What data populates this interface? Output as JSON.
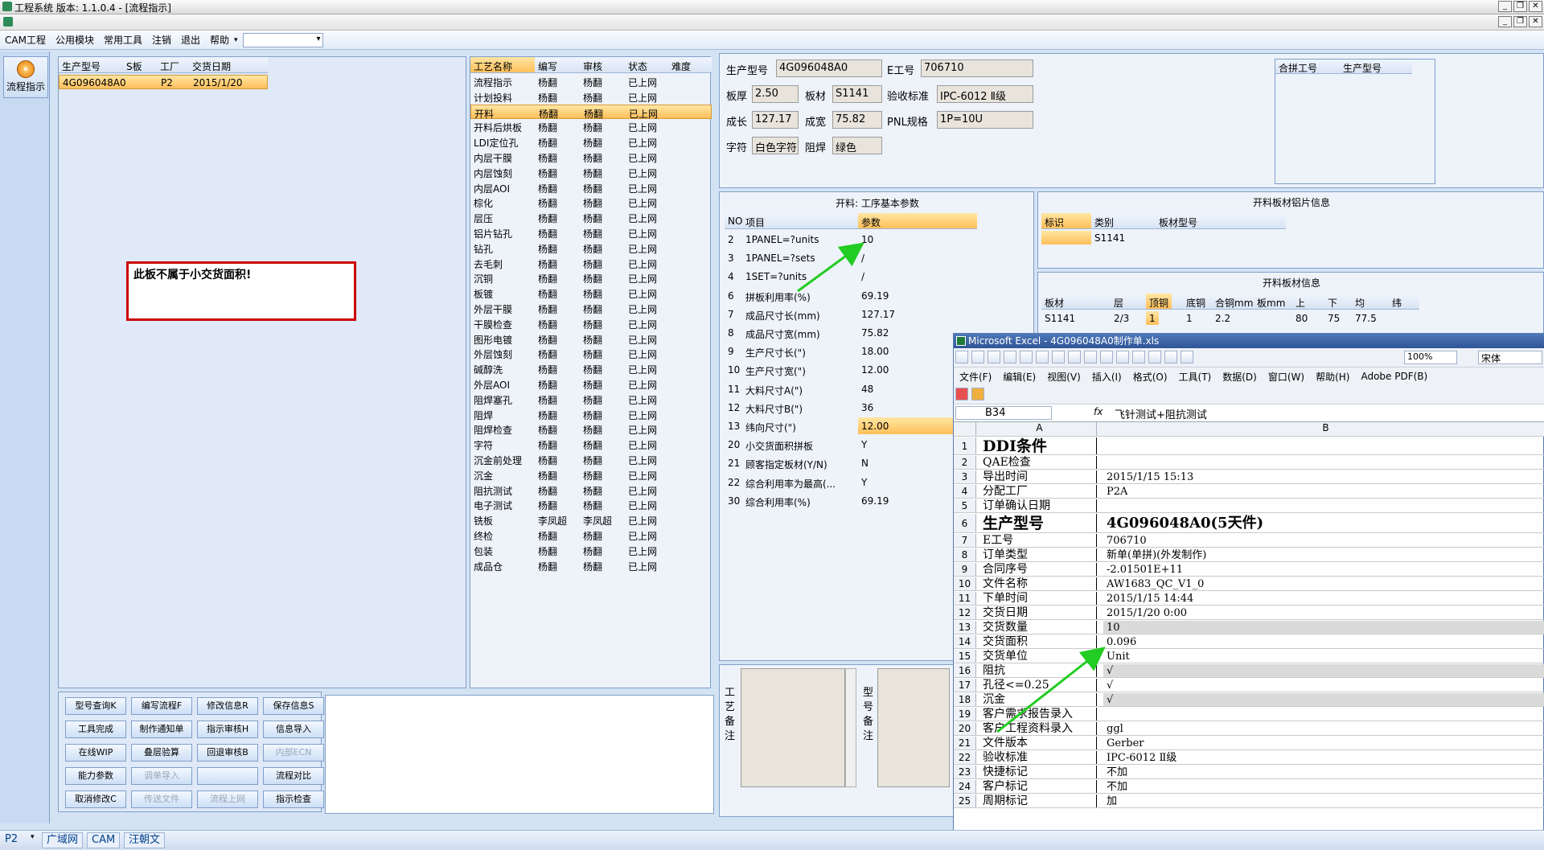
{
  "window": {
    "title": "工程系统    版本: 1.1.0.4 - [流程指示]"
  },
  "menu": {
    "items": [
      "CAM工程",
      "公用模块",
      "常用工具",
      "注销",
      "退出",
      "帮助"
    ]
  },
  "left_nav": {
    "flow_label": "流程指示"
  },
  "model_grid": {
    "headers": [
      "生产型号",
      "S板",
      "工厂",
      "交货日期"
    ],
    "row": [
      "4G096048A0",
      "",
      "P2",
      "2015/1/20"
    ]
  },
  "alert_text": "此板不属于小交货面积!",
  "process_grid": {
    "headers": [
      "工艺名称",
      "编写",
      "审核",
      "状态",
      "难度"
    ],
    "rows": [
      [
        "流程指示",
        "杨翻",
        "杨翻",
        "已上网"
      ],
      [
        "计划投料",
        "杨翻",
        "杨翻",
        "已上网"
      ],
      [
        "开料",
        "杨翻",
        "杨翻",
        "已上网"
      ],
      [
        "开料后烘板",
        "杨翻",
        "杨翻",
        "已上网"
      ],
      [
        "LDI定位孔",
        "杨翻",
        "杨翻",
        "已上网"
      ],
      [
        "内层干膜",
        "杨翻",
        "杨翻",
        "已上网"
      ],
      [
        "内层蚀刻",
        "杨翻",
        "杨翻",
        "已上网"
      ],
      [
        "内层AOI",
        "杨翻",
        "杨翻",
        "已上网"
      ],
      [
        "棕化",
        "杨翻",
        "杨翻",
        "已上网"
      ],
      [
        "层压",
        "杨翻",
        "杨翻",
        "已上网"
      ],
      [
        "铝片钻孔",
        "杨翻",
        "杨翻",
        "已上网"
      ],
      [
        "钻孔",
        "杨翻",
        "杨翻",
        "已上网"
      ],
      [
        "去毛刺",
        "杨翻",
        "杨翻",
        "已上网"
      ],
      [
        "沉铜",
        "杨翻",
        "杨翻",
        "已上网"
      ],
      [
        "板镀",
        "杨翻",
        "杨翻",
        "已上网"
      ],
      [
        "外层干膜",
        "杨翻",
        "杨翻",
        "已上网"
      ],
      [
        "干膜检查",
        "杨翻",
        "杨翻",
        "已上网"
      ],
      [
        "图形电镀",
        "杨翻",
        "杨翻",
        "已上网"
      ],
      [
        "外层蚀刻",
        "杨翻",
        "杨翻",
        "已上网"
      ],
      [
        "碱醇洗",
        "杨翻",
        "杨翻",
        "已上网"
      ],
      [
        "外层AOI",
        "杨翻",
        "杨翻",
        "已上网"
      ],
      [
        "阻焊塞孔",
        "杨翻",
        "杨翻",
        "已上网"
      ],
      [
        "阻焊",
        "杨翻",
        "杨翻",
        "已上网"
      ],
      [
        "阻焊检查",
        "杨翻",
        "杨翻",
        "已上网"
      ],
      [
        "字符",
        "杨翻",
        "杨翻",
        "已上网"
      ],
      [
        "沉金前处理",
        "杨翻",
        "杨翻",
        "已上网"
      ],
      [
        "沉金",
        "杨翻",
        "杨翻",
        "已上网"
      ],
      [
        "阻抗测试",
        "杨翻",
        "杨翻",
        "已上网"
      ],
      [
        "电子测试",
        "杨翻",
        "杨翻",
        "已上网"
      ],
      [
        "铣板",
        "李凤超",
        "李凤超",
        "已上网"
      ],
      [
        "终检",
        "杨翻",
        "杨翻",
        "已上网"
      ],
      [
        "包装",
        "杨翻",
        "杨翻",
        "已上网"
      ],
      [
        "成品仓",
        "杨翻",
        "杨翻",
        "已上网"
      ]
    ]
  },
  "buttons": [
    [
      "型号查询K",
      "编写流程F",
      "修改信息R",
      "保存信息S"
    ],
    [
      "工具完成",
      "制作通知单",
      "指示审核H",
      "信息导入"
    ],
    [
      "在线WIP",
      "叠层验算",
      "回退审核B",
      "内部ECN"
    ],
    [
      "能力参数",
      "调单导入",
      "",
      "流程对比"
    ],
    [
      "取消修改C",
      "传送文件",
      "流程上网",
      "指示检查"
    ]
  ],
  "info": {
    "labels": {
      "model": "生产型号",
      "e_no": "E工号",
      "thick": "板厚",
      "material": "板材",
      "accept": "验收标准",
      "len": "成长",
      "width": "成宽",
      "pnl": "PNL规格",
      "char": "字符",
      "mask": "阻焊"
    },
    "values": {
      "model": "4G096048A0",
      "e_no": "706710",
      "thick": "2.50",
      "material": "S1141",
      "accept": "IPC-6012 Ⅱ级",
      "len": "127.17",
      "width": "75.82",
      "pnl": "1P=10U",
      "char": "白色字符",
      "mask": "绿色"
    }
  },
  "merge_grid": {
    "headers": [
      "合拼工号",
      "生产型号"
    ]
  },
  "params": {
    "title": "开料: 工序基本参数",
    "headers": [
      "NO",
      "项目",
      "参数"
    ],
    "rows": [
      [
        "2",
        "1PANEL=?units",
        "10"
      ],
      [
        "3",
        "1PANEL=?sets",
        "/"
      ],
      [
        "4",
        "1SET=?units",
        "/"
      ],
      [
        "6",
        "拼板利用率(%)",
        "69.19"
      ],
      [
        "7",
        "成品尺寸长(mm)",
        "127.17"
      ],
      [
        "8",
        "成品尺寸宽(mm)",
        "75.82"
      ],
      [
        "9",
        "生产尺寸长(\")",
        "18.00"
      ],
      [
        "10",
        "生产尺寸宽(\")",
        "12.00"
      ],
      [
        "11",
        "大料尺寸A(\")",
        "48"
      ],
      [
        "12",
        "大料尺寸B(\")",
        "36"
      ],
      [
        "13",
        "纬向尺寸(\")",
        "12.00"
      ],
      [
        "20",
        "小交货面积拼板",
        "Y"
      ],
      [
        "21",
        "顾客指定板材(Y/N)",
        "N"
      ],
      [
        "22",
        "综合利用率为最高(...",
        "Y"
      ],
      [
        "30",
        "综合利用率(%)",
        "69.19"
      ]
    ]
  },
  "foil": {
    "title": "开料板材铝片信息",
    "headers": [
      "标识",
      "类别",
      "板材型号"
    ],
    "row": [
      "",
      "S1141",
      ""
    ]
  },
  "sheet": {
    "title": "开料板材信息",
    "headers": [
      "板材",
      "层",
      "顶铜",
      "底铜",
      "合铜mm",
      "板mm",
      "上",
      "下",
      "均",
      "纬"
    ],
    "row": [
      "S1141",
      "2/3",
      "1",
      "1",
      "2.2",
      "",
      "80",
      "75",
      "77.5",
      ""
    ]
  },
  "notes": {
    "process": "工艺备注",
    "model": "型号备注"
  },
  "excel": {
    "title": "Microsoft Excel - 4G096048A0制作单.xls",
    "menu": [
      "文件(F)",
      "编辑(E)",
      "视图(V)",
      "插入(I)",
      "格式(O)",
      "工具(T)",
      "数据(D)",
      "窗口(W)",
      "帮助(H)",
      "Adobe PDF(B)"
    ],
    "zoom": "100%",
    "font": "宋体",
    "cell_ref": "B34",
    "formula": "飞针测试+阻抗测试",
    "col_a": "A",
    "col_b": "B",
    "rows": [
      [
        "1",
        "DDI条件",
        ""
      ],
      [
        "2",
        "QAE检查",
        ""
      ],
      [
        "3",
        "导出时间",
        "2015/1/15 15:13"
      ],
      [
        "4",
        "分配工厂",
        "P2A"
      ],
      [
        "5",
        "订单确认日期",
        ""
      ],
      [
        "6",
        "生产型号",
        "4G096048A0(5天件)"
      ],
      [
        "7",
        "E工号",
        "706710"
      ],
      [
        "8",
        "订单类型",
        "新单(单拼)(外发制作)"
      ],
      [
        "9",
        "合同序号",
        "-2.01501E+11"
      ],
      [
        "10",
        "文件名称",
        "AW1683_QC_V1_0"
      ],
      [
        "11",
        "下单时间",
        "2015/1/15 14:44"
      ],
      [
        "12",
        "交货日期",
        "2015/1/20 0:00"
      ],
      [
        "13",
        "交货数量",
        "10"
      ],
      [
        "14",
        "交货面积",
        "0.096"
      ],
      [
        "15",
        "交货单位",
        "Unit"
      ],
      [
        "16",
        "阻抗",
        "√"
      ],
      [
        "17",
        "孔径<=0.25",
        "√"
      ],
      [
        "18",
        "沉金",
        "√"
      ],
      [
        "19",
        "客户需求报告录入",
        ""
      ],
      [
        "20",
        "客户工程资料录入",
        "ggl"
      ],
      [
        "21",
        "文件版本",
        "Gerber"
      ],
      [
        "22",
        "验收标准",
        "IPC-6012 Ⅱ级"
      ],
      [
        "23",
        "快捷标记",
        "不加"
      ],
      [
        "24",
        "客户标记",
        "不加"
      ],
      [
        "25",
        "周期标记",
        "加"
      ]
    ]
  },
  "status": {
    "plant": "P2",
    "tabs": [
      "广域网",
      "CAM",
      "汪朝文"
    ]
  },
  "colors": {
    "accent_select": "#ffbf5a",
    "arrow": "#22cc22",
    "alert_border": "#cc0000"
  }
}
